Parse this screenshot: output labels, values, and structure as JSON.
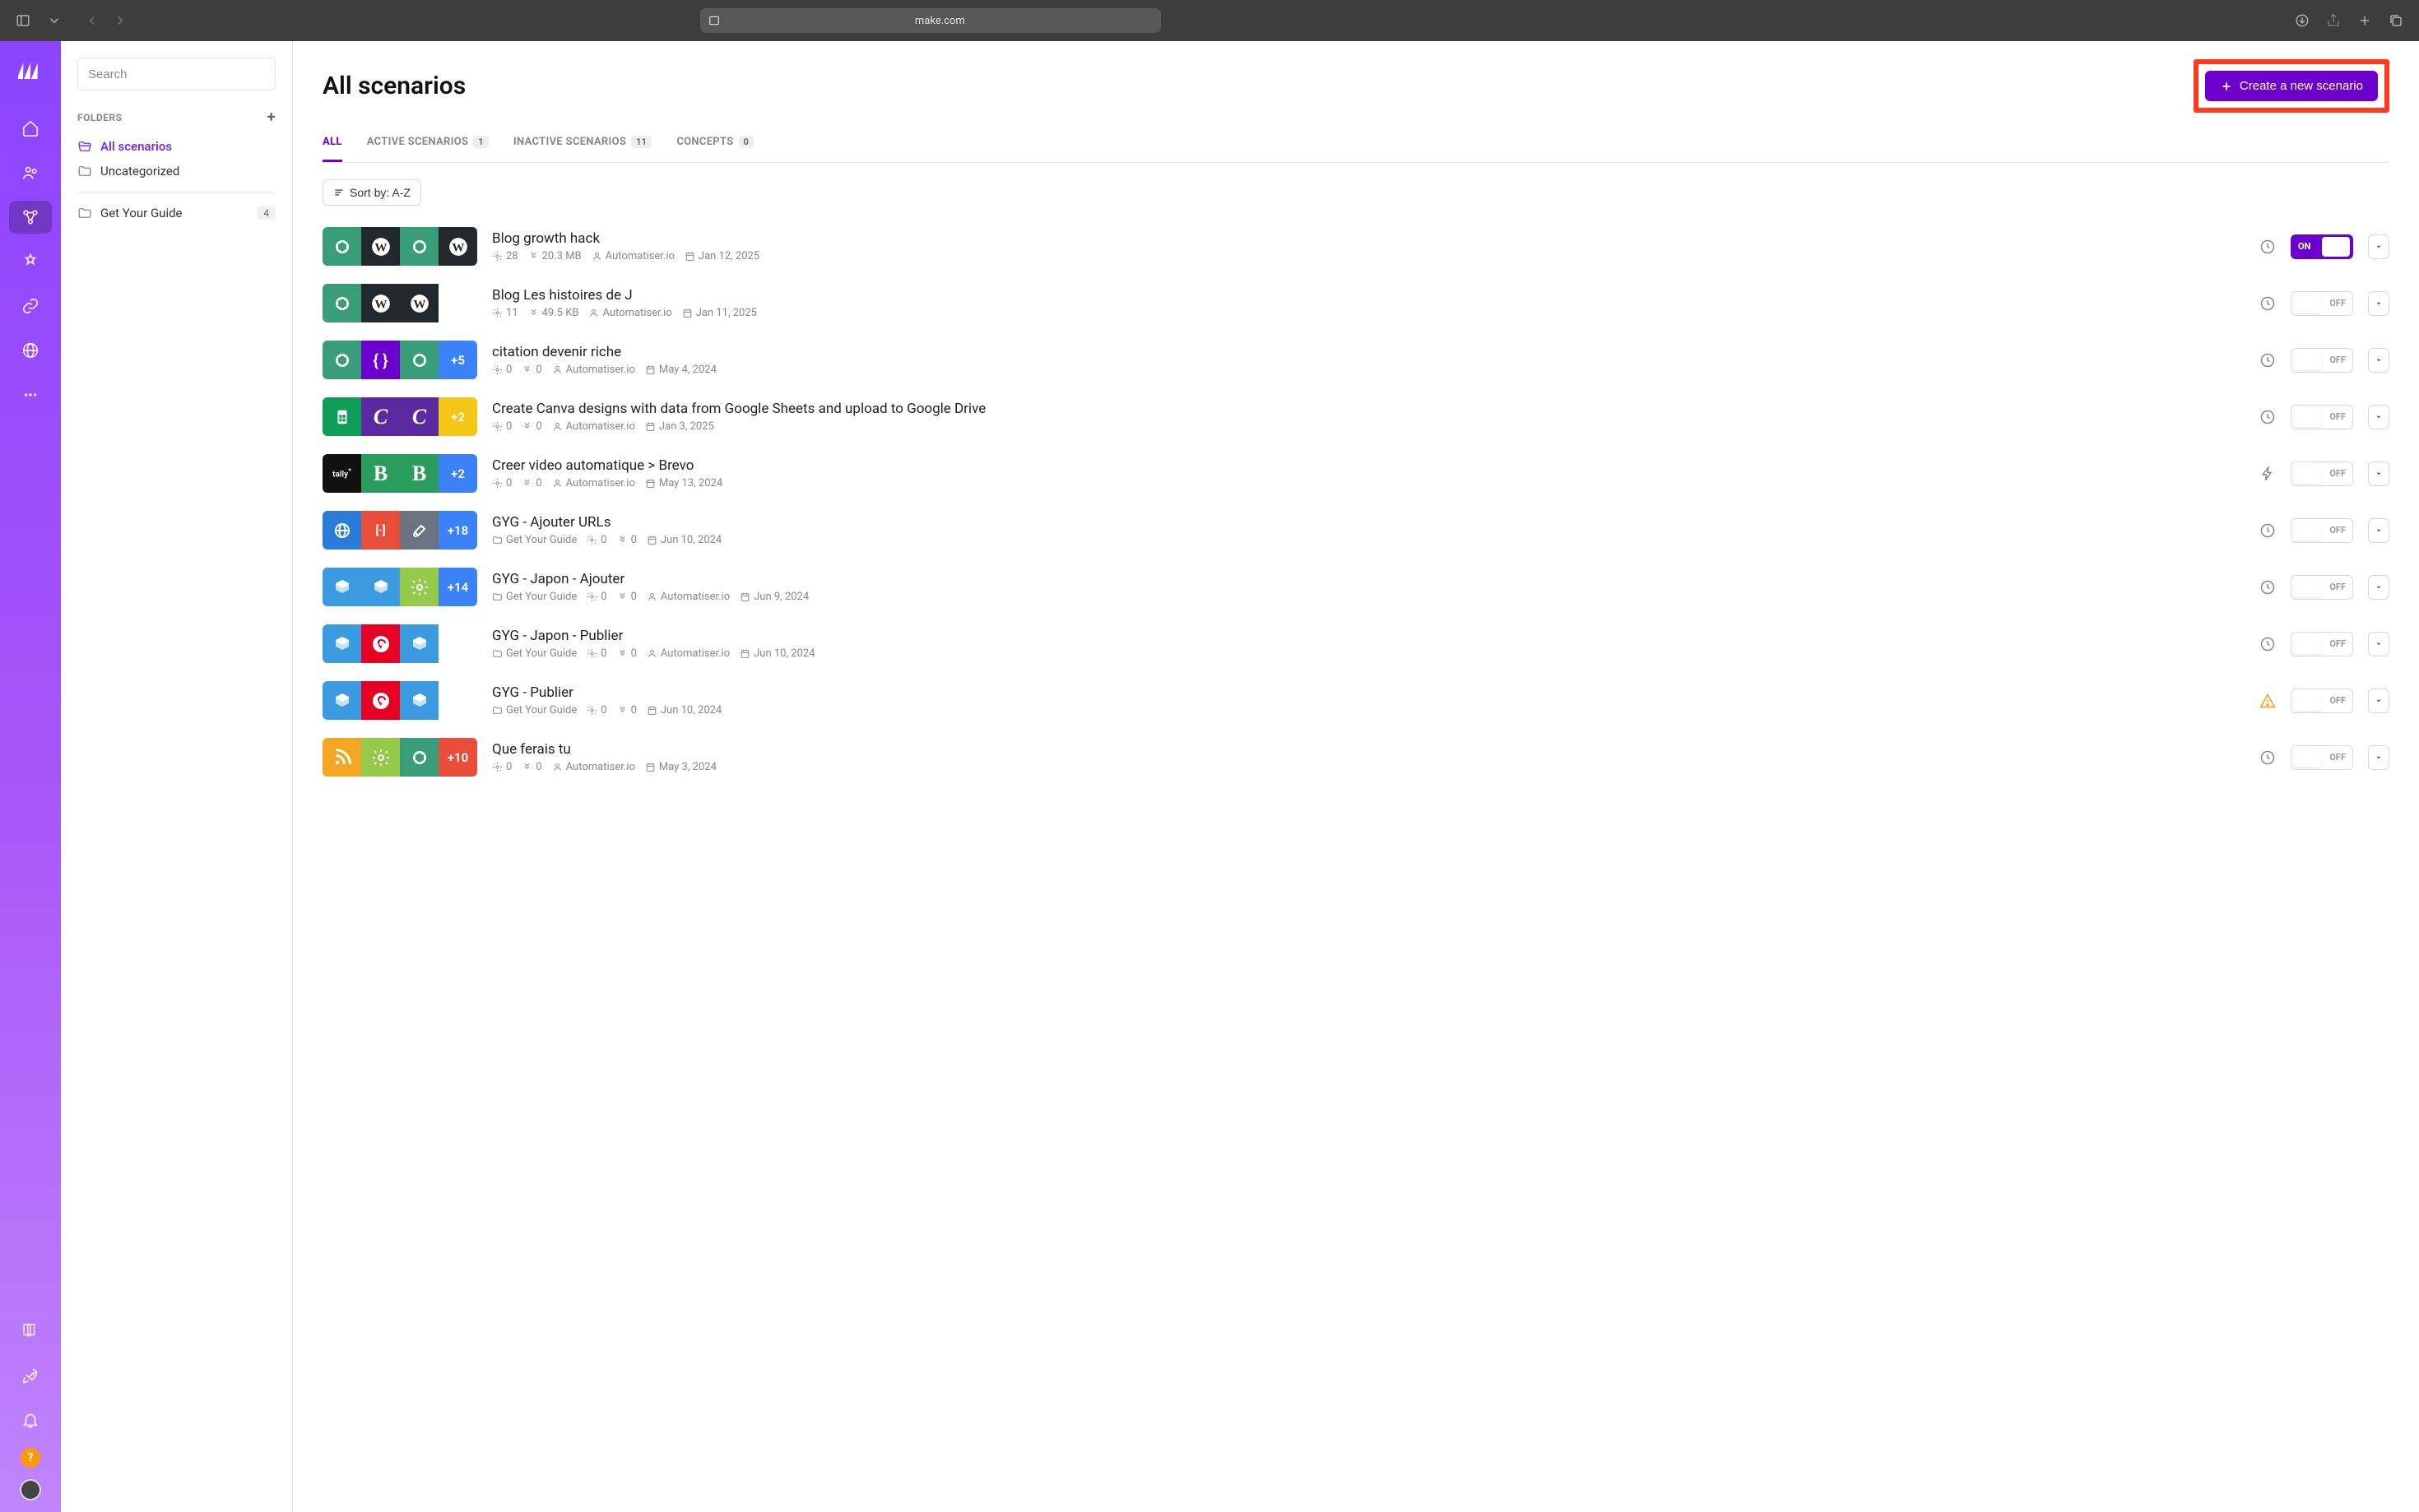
{
  "browser": {
    "url": "make.com"
  },
  "sidebar": {
    "search_placeholder": "Search",
    "folders_header": "FOLDERS",
    "all_scenarios": "All scenarios",
    "uncategorized": "Uncategorized",
    "custom_folder": {
      "name": "Get Your Guide",
      "count": "4"
    }
  },
  "header": {
    "title": "All scenarios",
    "create_label": "Create a new scenario"
  },
  "tabs": [
    {
      "label": "ALL",
      "badge": ""
    },
    {
      "label": "ACTIVE SCENARIOS",
      "badge": "1"
    },
    {
      "label": "INACTIVE SCENARIOS",
      "badge": "11"
    },
    {
      "label": "CONCEPTS",
      "badge": "0"
    }
  ],
  "sort_label": "Sort by: A-Z",
  "toggle_on_label": "ON",
  "toggle_off_label": "OFF",
  "scenarios": [
    {
      "title": "Blog growth hack",
      "ops": "28",
      "size": "20.3 MB",
      "owner": "Automatiser.io",
      "date": "Jan 12, 2025",
      "folder": "",
      "on": true,
      "status": "clock",
      "icons": [
        {
          "bg": "#3a9d7a",
          "glyph": "openai"
        },
        {
          "bg": "#23282d",
          "glyph": "wp"
        },
        {
          "bg": "#3a9d7a",
          "glyph": "openai"
        },
        {
          "bg": "#23282d",
          "glyph": "wp"
        }
      ]
    },
    {
      "title": "Blog Les histoires de J",
      "ops": "11",
      "size": "49.5 KB",
      "owner": "Automatiser.io",
      "date": "Jan 11, 2025",
      "folder": "",
      "on": false,
      "status": "clock",
      "icons": [
        {
          "bg": "#3a9d7a",
          "glyph": "openai"
        },
        {
          "bg": "#23282d",
          "glyph": "wp"
        },
        {
          "bg": "#23282d",
          "glyph": "wp"
        },
        {
          "bg": "#ffffff",
          "glyph": ""
        }
      ]
    },
    {
      "title": "citation devenir riche",
      "ops": "0",
      "size": "0",
      "owner": "Automatiser.io",
      "date": "May 4, 2024",
      "folder": "",
      "on": false,
      "status": "clock",
      "icons": [
        {
          "bg": "#3a9d7a",
          "glyph": "openai"
        },
        {
          "bg": "#6d00cc",
          "glyph": "json"
        },
        {
          "bg": "#3a9d7a",
          "glyph": "openai"
        },
        {
          "bg": "#3b82f6",
          "glyph": "+5"
        }
      ]
    },
    {
      "title": "Create Canva designs with data from Google Sheets and upload to Google Drive",
      "ops": "0",
      "size": "0",
      "owner": "Automatiser.io",
      "date": "Jan 3, 2025",
      "folder": "",
      "on": false,
      "status": "clock",
      "icons": [
        {
          "bg": "#0f9d58",
          "glyph": "sheets"
        },
        {
          "bg": "#5b2aa0",
          "glyph": "C"
        },
        {
          "bg": "#5b2aa0",
          "glyph": "C"
        },
        {
          "bg": "#f5c518",
          "glyph": "+2"
        }
      ]
    },
    {
      "title": "Creer video automatique > Brevo",
      "ops": "0",
      "size": "0",
      "owner": "Automatiser.io",
      "date": "May 13, 2024",
      "folder": "",
      "on": false,
      "status": "bolt",
      "icons": [
        {
          "bg": "#111111",
          "glyph": "tally"
        },
        {
          "bg": "#2a9d5c",
          "glyph": "B"
        },
        {
          "bg": "#2a9d5c",
          "glyph": "B"
        },
        {
          "bg": "#3b82f6",
          "glyph": "+2"
        }
      ]
    },
    {
      "title": "GYG - Ajouter URLs",
      "ops": "0",
      "size": "0",
      "owner": "",
      "date": "Jun 10, 2024",
      "folder": "Get Your Guide",
      "on": false,
      "status": "clock",
      "icons": [
        {
          "bg": "#2a7cd8",
          "glyph": "globe"
        },
        {
          "bg": "#e94e3b",
          "glyph": "http"
        },
        {
          "bg": "#6b7280",
          "glyph": "tools"
        },
        {
          "bg": "#3b82f6",
          "glyph": "+18"
        }
      ]
    },
    {
      "title": "GYG - Japon - Ajouter",
      "ops": "0",
      "size": "0",
      "owner": "Automatiser.io",
      "date": "Jun 9, 2024",
      "folder": "Get Your Guide",
      "on": false,
      "status": "clock",
      "icons": [
        {
          "bg": "#3b9ae0",
          "glyph": "box"
        },
        {
          "bg": "#3b9ae0",
          "glyph": "box"
        },
        {
          "bg": "#94c94a",
          "glyph": "gear"
        },
        {
          "bg": "#3b82f6",
          "glyph": "+14"
        }
      ]
    },
    {
      "title": "GYG - Japon - Publier",
      "ops": "0",
      "size": "0",
      "owner": "Automatiser.io",
      "date": "Jun 10, 2024",
      "folder": "Get Your Guide",
      "on": false,
      "status": "clock",
      "icons": [
        {
          "bg": "#3b9ae0",
          "glyph": "box"
        },
        {
          "bg": "#e60023",
          "glyph": "pin"
        },
        {
          "bg": "#3b9ae0",
          "glyph": "box"
        },
        {
          "bg": "#ffffff",
          "glyph": ""
        }
      ]
    },
    {
      "title": "GYG - Publier",
      "ops": "0",
      "size": "0",
      "owner": "",
      "date": "Jun 10, 2024",
      "folder": "Get Your Guide",
      "on": false,
      "status": "warn",
      "icons": [
        {
          "bg": "#3b9ae0",
          "glyph": "box"
        },
        {
          "bg": "#e60023",
          "glyph": "pin"
        },
        {
          "bg": "#3b9ae0",
          "glyph": "box"
        },
        {
          "bg": "#ffffff",
          "glyph": ""
        }
      ]
    },
    {
      "title": "Que ferais tu",
      "ops": "0",
      "size": "0",
      "owner": "Automatiser.io",
      "date": "May 3, 2024",
      "folder": "",
      "on": false,
      "status": "clock",
      "icons": [
        {
          "bg": "#f5a623",
          "glyph": "rss"
        },
        {
          "bg": "#94c94a",
          "glyph": "gear"
        },
        {
          "bg": "#3a9d7a",
          "glyph": "openai"
        },
        {
          "bg": "#e94e3b",
          "glyph": "+10"
        }
      ]
    }
  ]
}
